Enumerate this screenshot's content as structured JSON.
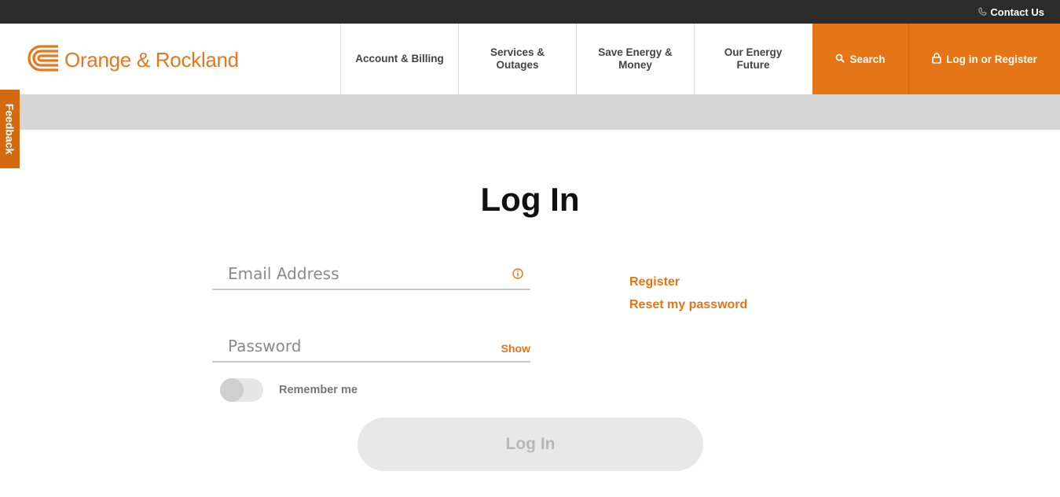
{
  "topbar": {
    "contact_label": "Contact Us"
  },
  "header": {
    "logo_text": "Orange & Rockland",
    "nav": [
      {
        "label": "Account & Billing"
      },
      {
        "label": "Services & Outages"
      },
      {
        "label": "Save Energy & Money"
      },
      {
        "label": "Our Energy Future"
      }
    ],
    "search_label": "Search",
    "login_label": "Log in or Register"
  },
  "feedback_label": "Feedback",
  "page": {
    "title": "Log In",
    "email_placeholder": "Email Address",
    "email_value": "",
    "password_placeholder": "Password",
    "password_value": "",
    "show_label": "Show",
    "remember_label": "Remember me",
    "remember_checked": false,
    "submit_label": "Log In",
    "links": {
      "register": "Register",
      "reset": "Reset my password"
    }
  },
  "icons": {
    "phone": "phone-icon",
    "search": "search-icon",
    "lock": "lock-icon",
    "info": "info-icon",
    "logo": "orange-rockland-logo-icon"
  },
  "colors": {
    "brand": "#e57517",
    "topbar": "#2b2b2b",
    "band": "#d6d6d6"
  }
}
